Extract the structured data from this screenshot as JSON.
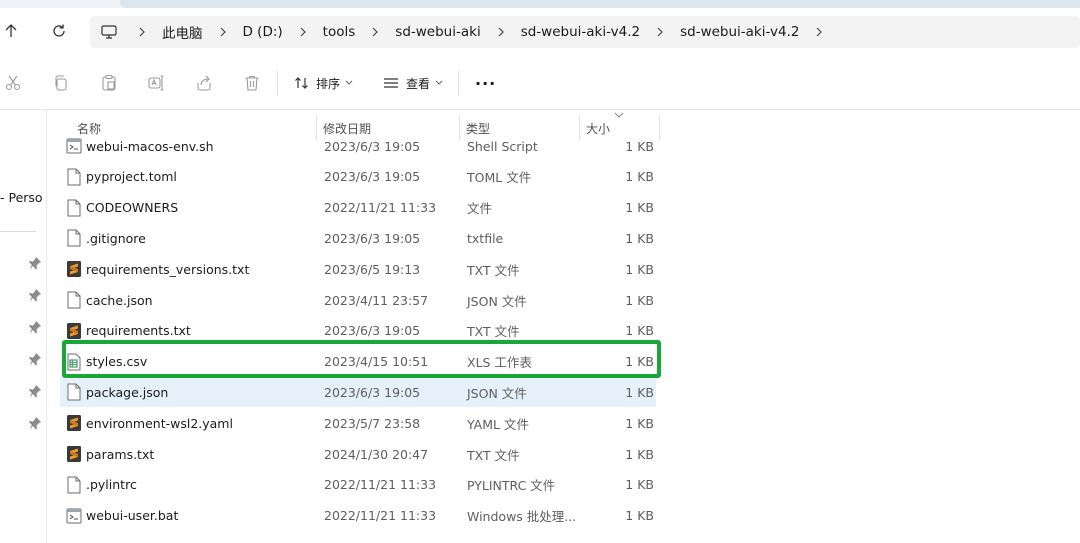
{
  "breadcrumb": [
    "此电脑",
    "D (D:)",
    "tools",
    "sd-webui-aki",
    "sd-webui-aki-v4.2",
    "sd-webui-aki-v4.2"
  ],
  "toolbar": {
    "sort_label": "排序",
    "view_label": "查看",
    "more_label": "···"
  },
  "nav": {
    "partial_item": "- Perso"
  },
  "columns": {
    "name": "名称",
    "date": "修改日期",
    "type": "类型",
    "size": "大小"
  },
  "files": [
    {
      "name": "webui-macos-env.sh",
      "date": "2023/6/3 19:05",
      "type": "Shell Script",
      "size": "1 KB",
      "icon": "script-file-icon"
    },
    {
      "name": "pyproject.toml",
      "date": "2023/6/3 19:05",
      "type": "TOML 文件",
      "size": "1 KB",
      "icon": "file-icon"
    },
    {
      "name": "CODEOWNERS",
      "date": "2022/11/21 11:33",
      "type": "文件",
      "size": "1 KB",
      "icon": "file-icon"
    },
    {
      "name": ".gitignore",
      "date": "2023/6/3 19:05",
      "type": "txtfile",
      "size": "1 KB",
      "icon": "file-icon"
    },
    {
      "name": "requirements_versions.txt",
      "date": "2023/6/5 19:13",
      "type": "TXT 文件",
      "size": "1 KB",
      "icon": "sublime-file-icon"
    },
    {
      "name": "cache.json",
      "date": "2023/4/11 23:57",
      "type": "JSON 文件",
      "size": "1 KB",
      "icon": "file-icon"
    },
    {
      "name": "requirements.txt",
      "date": "2023/6/3 19:05",
      "type": "TXT 文件",
      "size": "1 KB",
      "icon": "sublime-file-icon"
    },
    {
      "name": "styles.csv",
      "date": "2023/4/15 10:51",
      "type": "XLS 工作表",
      "size": "1 KB",
      "icon": "spreadsheet-file-icon"
    },
    {
      "name": "package.json",
      "date": "2023/6/3 19:05",
      "type": "JSON 文件",
      "size": "1 KB",
      "icon": "file-icon"
    },
    {
      "name": "environment-wsl2.yaml",
      "date": "2023/5/7 23:58",
      "type": "YAML 文件",
      "size": "1 KB",
      "icon": "sublime-file-icon"
    },
    {
      "name": "params.txt",
      "date": "2024/1/30 20:47",
      "type": "TXT 文件",
      "size": "1 KB",
      "icon": "sublime-file-icon"
    },
    {
      "name": ".pylintrc",
      "date": "2022/11/21 11:33",
      "type": "PYLINTRC 文件",
      "size": "1 KB",
      "icon": "file-icon"
    },
    {
      "name": "webui-user.bat",
      "date": "2022/11/21 11:33",
      "type": "Windows 批处理...",
      "size": "1 KB",
      "icon": "script-file-icon"
    }
  ],
  "colors": {
    "highlight": "#1aa639",
    "selected_row": "#e6f0fb",
    "sublime_orange": "#f19a2a"
  }
}
